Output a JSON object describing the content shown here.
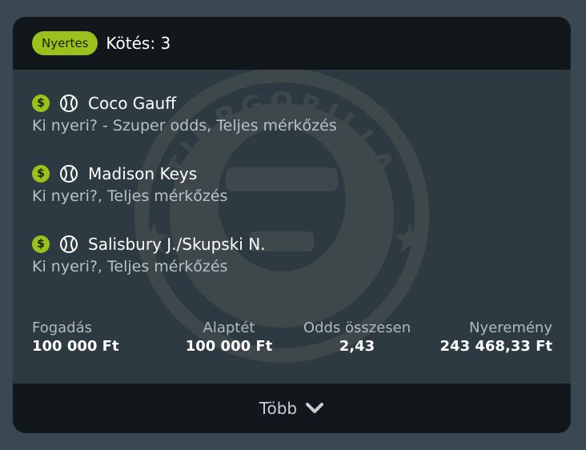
{
  "header": {
    "status_badge": "Nyertes",
    "bets_count": "Kötés: 3"
  },
  "bets": [
    {
      "name": "Coco Gauff",
      "desc": "Ki nyeri? - Szuper odds, Teljes mérkőzés"
    },
    {
      "name": "Madison Keys",
      "desc": "Ki nyeri?, Teljes mérkőzés"
    },
    {
      "name": "Salisbury J./Skupski N.",
      "desc": "Ki nyeri?, Teljes mérkőzés"
    }
  ],
  "stats": {
    "stake": {
      "label": "Fogadás",
      "value": "100 000 Ft"
    },
    "base": {
      "label": "Alaptét",
      "value": "100 000 Ft"
    },
    "odds": {
      "label": "Odds összesen",
      "value": "2,43"
    },
    "win": {
      "label": "Nyeremény",
      "value": "243 468,33 Ft"
    }
  },
  "footer": {
    "more_label": "Több"
  },
  "icons": {
    "dollar": "dollar-icon",
    "tennis_ball": "tennis-ball-icon",
    "chevron": "chevron-down-icon",
    "dollar_glyph": "$"
  },
  "colors": {
    "accent": "#9bc21c",
    "card_bg": "#2d3a42",
    "bar_bg": "#12171b"
  },
  "watermark": {
    "top_text": "TIPPGORILLA",
    "bottom_text": "WWW.TIPPGORILLA.HU"
  }
}
